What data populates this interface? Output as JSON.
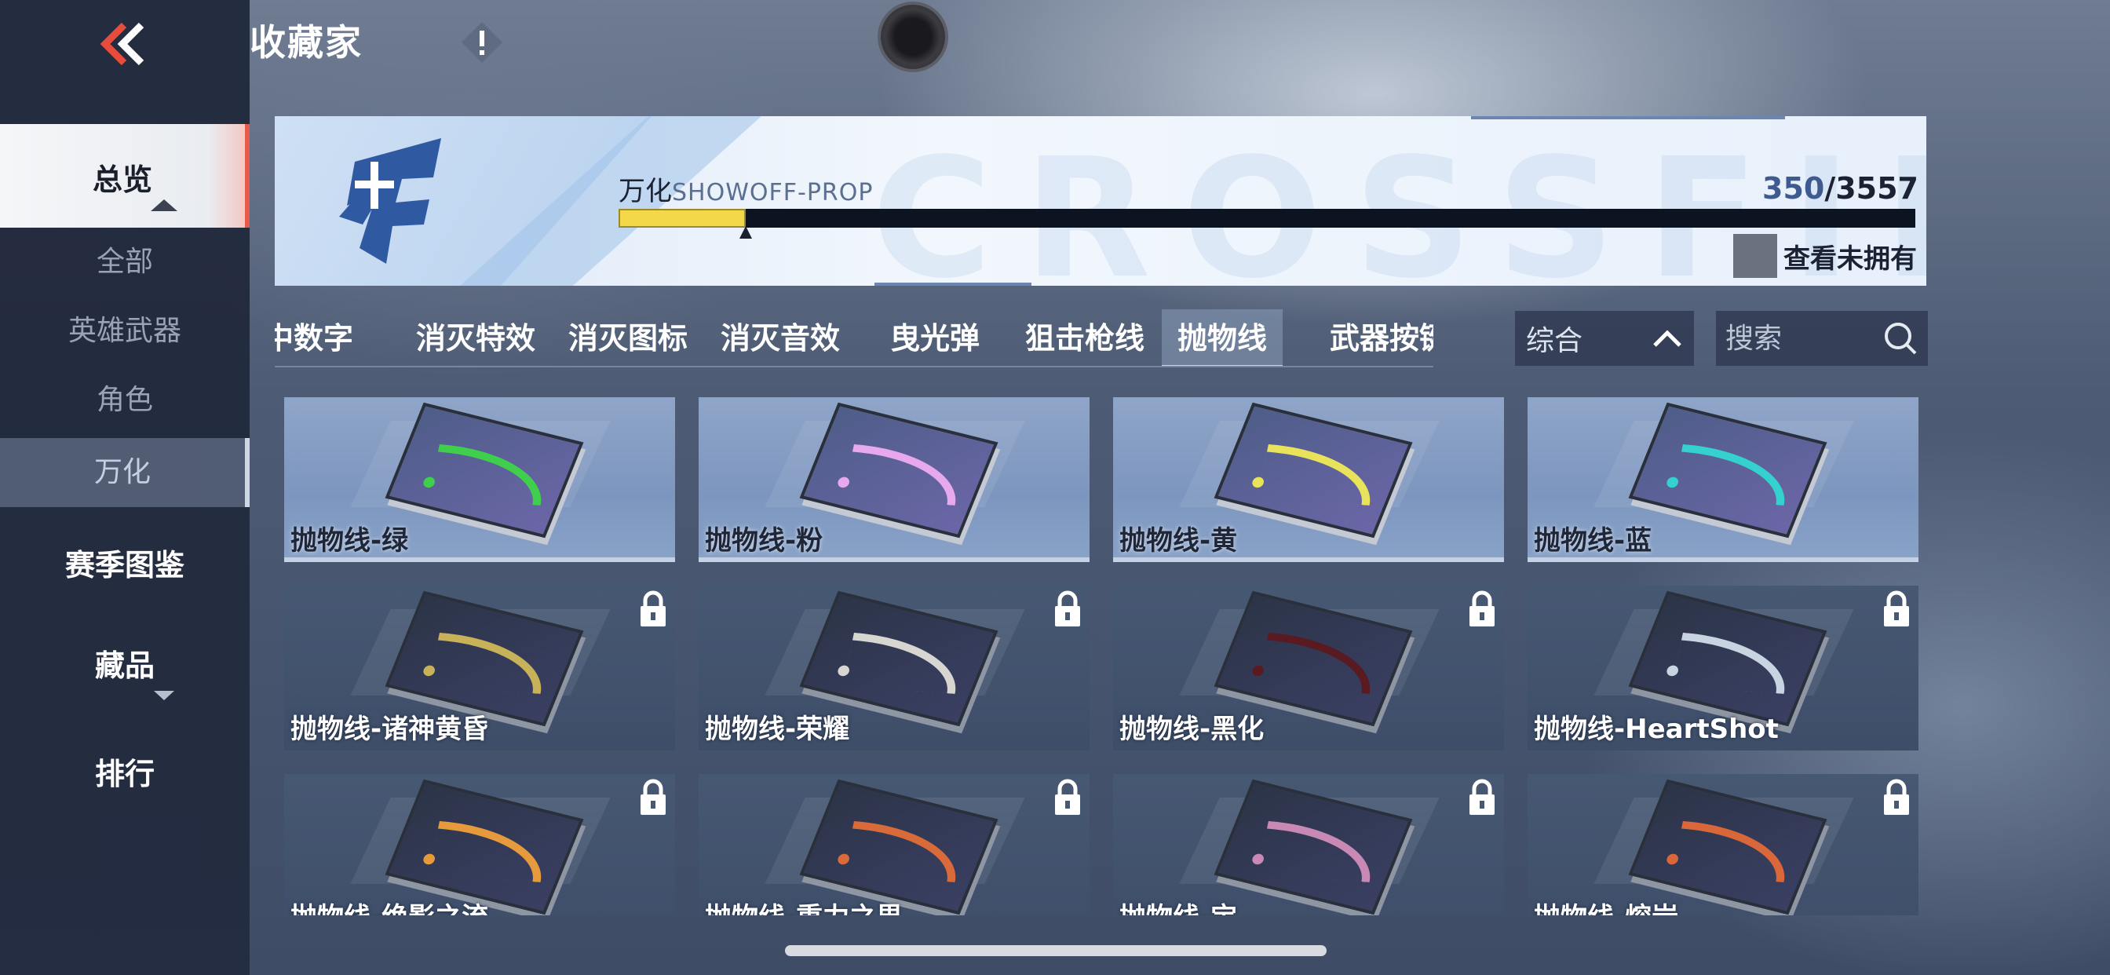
{
  "header": {
    "title": "收藏家"
  },
  "sidebar": {
    "overview": "总览",
    "sub_items": [
      "全部",
      "英雄武器",
      "角色",
      "万化"
    ],
    "active_sub": "万化",
    "season_catalog": "赛季图鉴",
    "collection": "藏品",
    "ranking": "排行"
  },
  "banner": {
    "category_cn": "万化",
    "category_en": "SHOWOFF-PROP",
    "owned": "350",
    "total": "/3557",
    "progress": 0.098,
    "view_unowned": "查看未拥有",
    "bg_letters": "CROSSFIRE"
  },
  "tabs": [
    "命中数字",
    "消灭特效",
    "消灭图标",
    "消灭音效",
    "曳光弹",
    "狙击枪线",
    "抛物线",
    "武器按键"
  ],
  "active_tab": "抛物线",
  "sort": {
    "label": "综合"
  },
  "search": {
    "placeholder": "搜索"
  },
  "items": [
    {
      "name": "抛物线-绿",
      "locked": false,
      "color": "#3fcf4c"
    },
    {
      "name": "抛物线-粉",
      "locked": false,
      "color": "#e7a8ee"
    },
    {
      "name": "抛物线-黄",
      "locked": false,
      "color": "#e8e35a"
    },
    {
      "name": "抛物线-蓝",
      "locked": false,
      "color": "#35d1cf"
    },
    {
      "name": "抛物线-诸神黄昏",
      "locked": true,
      "color": "#c7b25a"
    },
    {
      "name": "抛物线-荣耀",
      "locked": true,
      "color": "#d8d6d0"
    },
    {
      "name": "抛物线-黑化",
      "locked": true,
      "color": "#5a1a22"
    },
    {
      "name": "抛物线-HeartShot",
      "locked": true,
      "color": "#c9d4e2"
    },
    {
      "name": "抛物线-绝影之流",
      "locked": true,
      "color": "#e69a3c"
    },
    {
      "name": "抛物线-重力之界",
      "locked": true,
      "color": "#d96a3a"
    },
    {
      "name": "抛物线-宝",
      "locked": true,
      "color": "#c88ab4"
    },
    {
      "name": "抛物线-熔岩",
      "locked": true,
      "color": "#d9673a"
    }
  ]
}
